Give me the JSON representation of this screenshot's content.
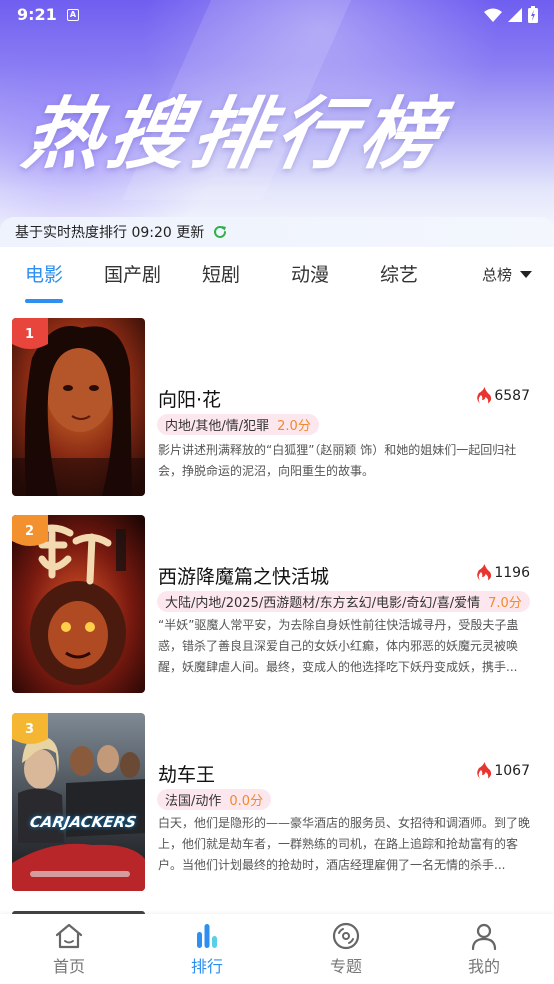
{
  "status_bar": {
    "time": "9:21",
    "notification": "A"
  },
  "header": {
    "title": "热搜排行榜",
    "update_text": "基于实时热度排行 09:20 更新"
  },
  "tabs": [
    {
      "label": "电影",
      "active": true
    },
    {
      "label": "国产剧",
      "active": false
    },
    {
      "label": "短剧",
      "active": false
    },
    {
      "label": "动漫",
      "active": false
    },
    {
      "label": "综艺",
      "active": false
    }
  ],
  "rank_select": {
    "label": "总榜"
  },
  "colors": {
    "accent": "#2d8ff0",
    "heat": "#e8352f",
    "score": "#f08a2b",
    "tag_bg": "#fde7ee"
  },
  "items": [
    {
      "rank": "1",
      "title": "向阳·花",
      "heat": "6587",
      "tags": "内地/其他/情/犯罪",
      "score": "2.0分",
      "desc": "影片讲述刑满释放的“白狐狸”（赵丽颖 饰）和她的姐妹们一起回归社会，挣脱命运的泥沼，向阳重生的故事。",
      "badge_color": "#e8453c"
    },
    {
      "rank": "2",
      "title": "西游降魔篇之快活城",
      "heat": "1196",
      "tags": "大陆/内地/2025/西游题材/东方玄幻/电影/奇幻/喜/爱情",
      "score": "7.0分",
      "desc": "“半妖”驱魔人常平安，为去除自身妖性前往快活城寻丹，受殷夫子蛊惑，错杀了善良且深爱自己的女妖小红癫，体内邪恶的妖魔元灵被唤醒，妖魔肆虐人间。最终，变成人的他选择吃下妖丹变成妖，携手...",
      "badge_color": "#f3912f"
    },
    {
      "rank": "3",
      "title": "劫车王",
      "heat": "1067",
      "tags": "法国/动作",
      "score": "0.0分",
      "desc": "白天，他们是隐形的——豪华酒店的服务员、女招待和调酒师。到了晚上，他们就是劫车者，一群熟练的司机，在路上追踪和抢劫富有的客户。当他们计划最终的抢劫时，酒店经理雇佣了一名无情的杀手...",
      "badge_color": "#f5b731",
      "poster_text": "CARJACKERS"
    }
  ],
  "bottom_nav": [
    {
      "label": "首页",
      "icon": "home-icon",
      "active": false
    },
    {
      "label": "排行",
      "icon": "ranking-icon",
      "active": true
    },
    {
      "label": "专题",
      "icon": "disc-icon",
      "active": false
    },
    {
      "label": "我的",
      "icon": "profile-icon",
      "active": false
    }
  ]
}
